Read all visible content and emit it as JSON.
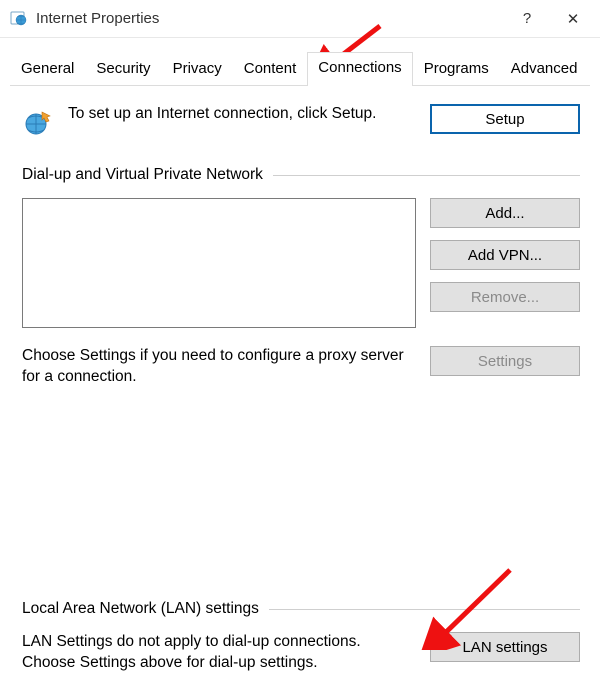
{
  "window": {
    "title": "Internet Properties",
    "help_symbol": "?",
    "close_symbol": "✕"
  },
  "tabs": {
    "general": "General",
    "security": "Security",
    "privacy": "Privacy",
    "content": "Content",
    "connections": "Connections",
    "programs": "Programs",
    "advanced": "Advanced",
    "active": "connections"
  },
  "setup": {
    "text": "To set up an Internet connection, click Setup.",
    "button": "Setup"
  },
  "dialup": {
    "heading": "Dial-up and Virtual Private Network",
    "add": "Add...",
    "add_vpn": "Add VPN...",
    "remove": "Remove...",
    "proxy_text": "Choose Settings if you need to configure a proxy server for a connection.",
    "settings": "Settings"
  },
  "lan": {
    "heading": "Local Area Network (LAN) settings",
    "text": "LAN Settings do not apply to dial-up connections. Choose Settings above for dial-up settings.",
    "button": "LAN settings"
  }
}
